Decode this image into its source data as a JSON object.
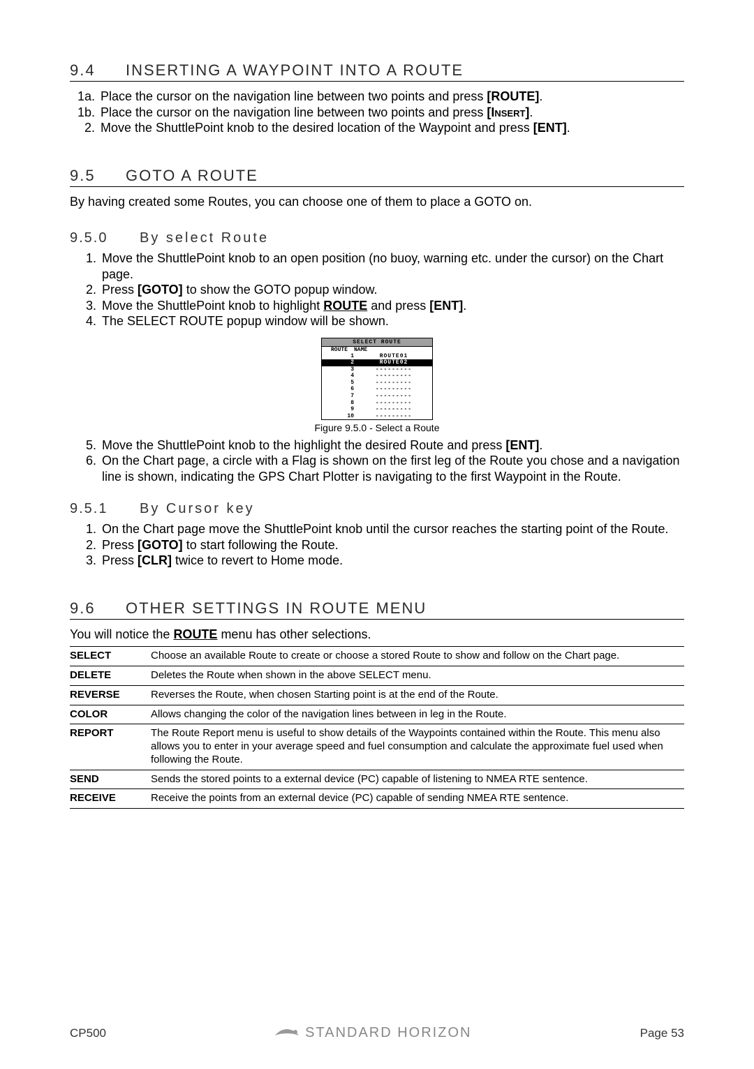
{
  "s94": {
    "num": "9.4",
    "title": "INSERTING A WAYPOINT INTO A ROUTE",
    "items": [
      {
        "m": "1a.",
        "pre": "Place the cursor on the navigation line between two points and press ",
        "key": "[ROUTE]",
        "post": "."
      },
      {
        "m": "1b.",
        "pre": "Place the cursor on the navigation line between two points and press ",
        "key": "[Insert]",
        "post": ".",
        "smallcaps": true
      },
      {
        "m": "2.",
        "pre": "Move the ShuttlePoint knob to the desired location of the Waypoint and press ",
        "key": "[ENT]",
        "post": "."
      }
    ]
  },
  "s95": {
    "num": "9.5",
    "title": "GOTO A ROUTE",
    "intro": "By having created some Routes, you can choose one of them to place a GOTO on."
  },
  "s950": {
    "num": "9.5.0",
    "title": "By select Route",
    "items_a": [
      {
        "m": "1.",
        "text": "Move the ShuttlePoint knob to an open position (no buoy, warning etc. under the cursor) on the Chart page."
      },
      {
        "m": "2.",
        "pre": "Press ",
        "key": "[GOTO]",
        "post": " to show the GOTO popup window."
      },
      {
        "m": "3.",
        "pre": "Move the ShuttlePoint knob to highlight ",
        "ulkey": "ROUTE",
        "mid": " and press ",
        "key": "[ENT]",
        "post": "."
      },
      {
        "m": "4.",
        "text": "The SELECT ROUTE popup window will be shown."
      }
    ],
    "figure": {
      "title": "SELECT ROUTE",
      "head_c1": "ROUTE",
      "head_c2": "NAME",
      "rows": [
        {
          "n": "1",
          "name": "ROUTE01",
          "hl": false
        },
        {
          "n": "2",
          "name": "ROUTE02",
          "hl": true
        },
        {
          "n": "3",
          "name": "---------",
          "hl": false
        },
        {
          "n": "4",
          "name": "---------",
          "hl": false
        },
        {
          "n": "5",
          "name": "---------",
          "hl": false
        },
        {
          "n": "6",
          "name": "---------",
          "hl": false
        },
        {
          "n": "7",
          "name": "---------",
          "hl": false
        },
        {
          "n": "8",
          "name": "---------",
          "hl": false
        },
        {
          "n": "9",
          "name": "---------",
          "hl": false
        },
        {
          "n": "10",
          "name": "---------",
          "hl": false
        }
      ],
      "caption": "Figure 9.5.0 -  Select a Route"
    },
    "items_b": [
      {
        "m": "5.",
        "pre": "Move the ShuttlePoint knob to the highlight the desired Route and press ",
        "key": "[ENT]",
        "post": "."
      },
      {
        "m": "6.",
        "text": "On the Chart page, a circle with a Flag is shown on the first leg of the Route you chose and a navigation line is shown, indicating the GPS Chart Plotter is navigating to the first Waypoint in the Route."
      }
    ]
  },
  "s951": {
    "num": "9.5.1",
    "title": "By Cursor key",
    "items": [
      {
        "m": "1.",
        "text": "On the Chart page move the ShuttlePoint knob until the cursor reaches the starting point of the Route."
      },
      {
        "m": "2.",
        "pre": "Press ",
        "key": "[GOTO]",
        "post": " to start following the Route."
      },
      {
        "m": "3.",
        "pre": "Press ",
        "key": "[CLR]",
        "post": " twice to revert to Home mode."
      }
    ]
  },
  "s96": {
    "num": "9.6",
    "title": "OTHER SETTINGS IN ROUTE MENU",
    "intro_pre": "You will notice the ",
    "intro_key": "ROUTE",
    "intro_post": " menu has other selections.",
    "rows": [
      {
        "k": "SELECT",
        "v": "Choose an available Route to create or choose a stored Route to show and follow on the Chart page."
      },
      {
        "k": "DELETE",
        "v": "Deletes the Route when shown in the above SELECT menu."
      },
      {
        "k": "REVERSE",
        "v": "Reverses the Route, when chosen Starting point is at the end of the Route."
      },
      {
        "k": "COLOR",
        "v": "Allows changing the color of the navigation lines between in leg in the Route."
      },
      {
        "k": "REPORT",
        "v": "The Route Report menu is useful to show details of the Waypoints contained within the Route. This menu also allows you to enter in your average speed and fuel consumption and calculate the approximate fuel used when following the Route."
      },
      {
        "k": "SEND",
        "v": "Sends the stored points to a external device (PC) capable of listening to NMEA RTE sentence."
      },
      {
        "k": "RECEIVE",
        "v": "Receive the points from an external device (PC) capable of sending NMEA RTE sentence."
      }
    ]
  },
  "footer": {
    "left": "CP500",
    "brand": "STANDARD HORIZON",
    "right": "Page 53"
  }
}
